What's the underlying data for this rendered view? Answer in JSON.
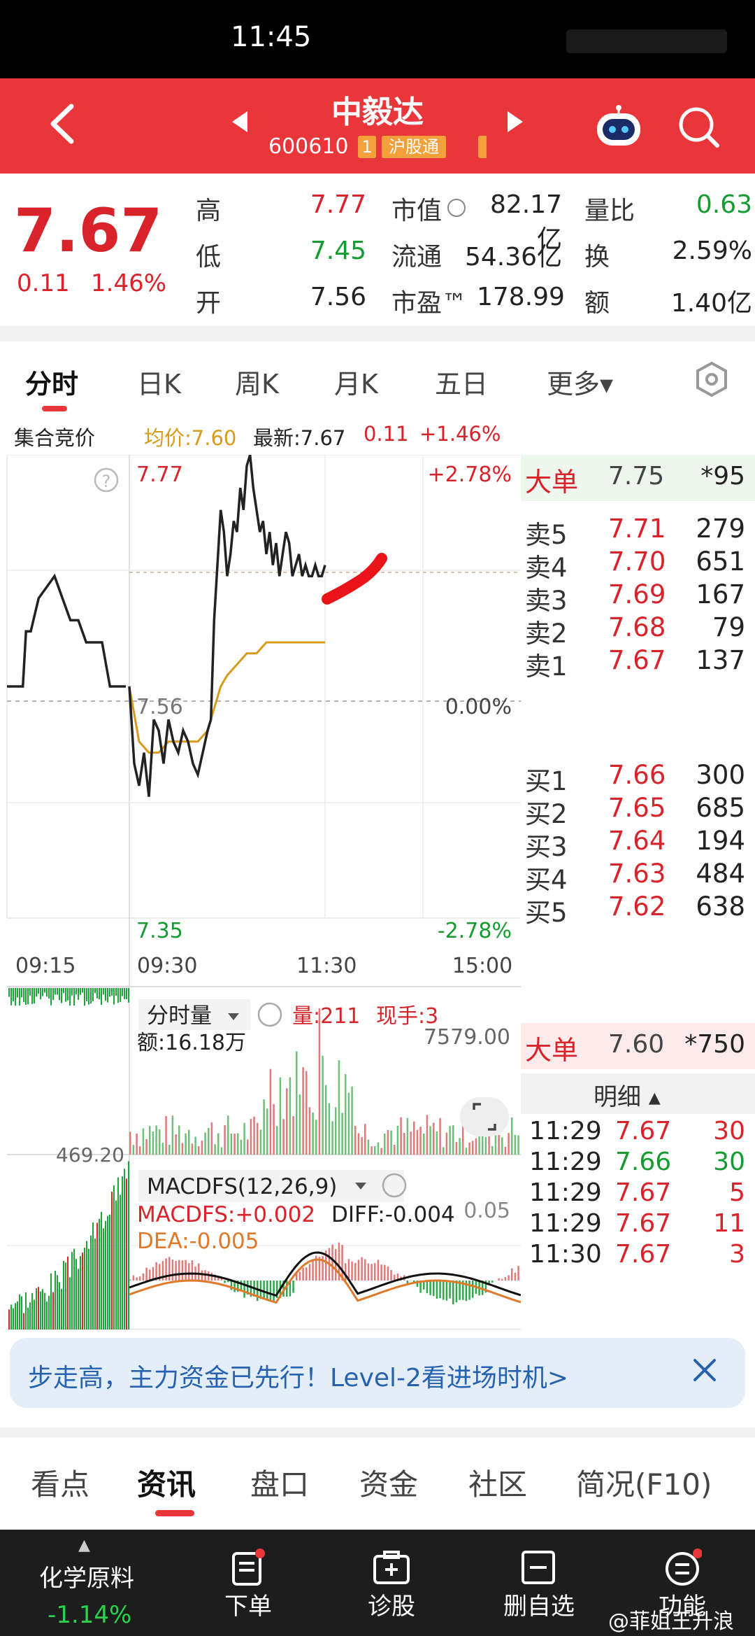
{
  "status_bar": {
    "time": "11:45"
  },
  "header": {
    "stock_name": "中毅达",
    "stock_code": "600610",
    "level_badge": "1",
    "market_badge": "沪股通",
    "back_icon": "chevron-left-icon",
    "prev_icon": "triangle-left-icon",
    "next_icon": "triangle-right-icon",
    "robot_icon": "robot-assistant-icon",
    "search_icon": "search-icon"
  },
  "quote": {
    "price": "7.67",
    "change": "0.11",
    "change_pct": "1.46%",
    "high_label": "高",
    "high": "7.77",
    "low_label": "低",
    "low": "7.45",
    "open_label": "开",
    "open": "7.56",
    "mktcap_label": "市值",
    "mktcap": "82.17亿",
    "float_label": "流通",
    "float": "54.36亿",
    "pe_label": "市盈™",
    "pe": "178.99",
    "volratio_label": "量比",
    "volratio": "0.63",
    "turnover_label": "换",
    "turnover": "2.59%",
    "amount_label": "额",
    "amount": "1.40亿"
  },
  "kline_tabs": [
    "分时",
    "日K",
    "周K",
    "月K",
    "五日",
    "更多▾"
  ],
  "info_line": {
    "auction": "集合竞价",
    "avg_price": "均价:7.60",
    "latest": "最新:7.67",
    "latest_chg": "0.11",
    "latest_pct": "+1.46%"
  },
  "chart_data": [
    {
      "type": "line",
      "title": "",
      "x_ticks": [
        "09:15",
        "09:30",
        "11:30",
        "15:00"
      ],
      "ylim": [
        7.35,
        7.77
      ],
      "y_labels": {
        "top": "7.77",
        "mid": "7.56",
        "bottom": "7.35"
      },
      "pct_labels": {
        "top": "+2.78%",
        "mid": "0.00%",
        "bottom": "-2.78%"
      },
      "series": [
        {
          "name": "",
          "color": "#222222",
          "points": [
            [
              0,
              7.56
            ],
            [
              3,
              7.49
            ],
            [
              6,
              7.47
            ],
            [
              9,
              7.5
            ],
            [
              12,
              7.46
            ],
            [
              15,
              7.53
            ],
            [
              18,
              7.52
            ],
            [
              21,
              7.49
            ],
            [
              24,
              7.53
            ],
            [
              27,
              7.51
            ],
            [
              30,
              7.5
            ],
            [
              33,
              7.52
            ],
            [
              36,
              7.51
            ],
            [
              39,
              7.49
            ],
            [
              42,
              7.48
            ],
            [
              45,
              7.5
            ],
            [
              48,
              7.52
            ],
            [
              50,
              7.53
            ],
            [
              52,
              7.62
            ],
            [
              54,
              7.67
            ],
            [
              56,
              7.72
            ],
            [
              58,
              7.7
            ],
            [
              60,
              7.66
            ],
            [
              62,
              7.68
            ],
            [
              64,
              7.71
            ],
            [
              66,
              7.7
            ],
            [
              68,
              7.74
            ],
            [
              70,
              7.72
            ],
            [
              72,
              7.76
            ],
            [
              74,
              7.77
            ],
            [
              76,
              7.74
            ],
            [
              78,
              7.72
            ],
            [
              80,
              7.7
            ],
            [
              82,
              7.71
            ],
            [
              84,
              7.68
            ],
            [
              86,
              7.7
            ],
            [
              88,
              7.67
            ],
            [
              90,
              7.69
            ],
            [
              92,
              7.66
            ],
            [
              94,
              7.68
            ],
            [
              96,
              7.7
            ],
            [
              98,
              7.69
            ],
            [
              100,
              7.66
            ],
            [
              102,
              7.67
            ],
            [
              104,
              7.68
            ],
            [
              106,
              7.66
            ],
            [
              108,
              7.67
            ],
            [
              110,
              7.66
            ],
            [
              112,
              7.66
            ],
            [
              114,
              7.67
            ],
            [
              116,
              7.66
            ],
            [
              118,
              7.66
            ],
            [
              120,
              7.67
            ]
          ]
        },
        {
          "name": "均价",
          "color": "#d69b1c",
          "points": [
            [
              0,
              7.56
            ],
            [
              6,
              7.51
            ],
            [
              12,
              7.5
            ],
            [
              18,
              7.5
            ],
            [
              24,
              7.51
            ],
            [
              30,
              7.51
            ],
            [
              36,
              7.51
            ],
            [
              42,
              7.51
            ],
            [
              48,
              7.52
            ],
            [
              52,
              7.54
            ],
            [
              56,
              7.56
            ],
            [
              60,
              7.57
            ],
            [
              66,
              7.58
            ],
            [
              72,
              7.59
            ],
            [
              78,
              7.59
            ],
            [
              84,
              7.6
            ],
            [
              90,
              7.6
            ],
            [
              96,
              7.6
            ],
            [
              102,
              7.6
            ],
            [
              108,
              7.6
            ],
            [
              114,
              7.6
            ],
            [
              120,
              7.6
            ]
          ]
        }
      ],
      "preopen_series": [
        [
          0,
          7.56
        ],
        [
          2,
          7.56
        ],
        [
          2.4,
          7.61
        ],
        [
          3,
          7.61
        ],
        [
          4,
          7.64
        ],
        [
          5,
          7.65
        ],
        [
          6,
          7.66
        ],
        [
          7,
          7.64
        ],
        [
          8,
          7.62
        ],
        [
          9,
          7.62
        ],
        [
          10,
          7.6
        ],
        [
          11,
          7.6
        ],
        [
          12,
          7.6
        ],
        [
          13,
          7.56
        ],
        [
          14,
          7.56
        ],
        [
          15,
          7.56
        ]
      ]
    },
    {
      "type": "bar",
      "title": "分时量",
      "volume_label": "量:211",
      "hand_label": "现手:3",
      "amount_label": "额:16.18万",
      "ymax_label": "7579.00",
      "preopen_label": "469.20"
    },
    {
      "type": "bar",
      "title": "MACDFS(12,26,9)",
      "macd_label": "MACDFS:+0.002",
      "diff_label": "DIFF:-0.004",
      "dea_label": "DEA:-0.005",
      "side_label": "0.05"
    }
  ],
  "orderbook": {
    "big_order_label": "大单",
    "big_order_top": {
      "price": "7.75",
      "vol": "*95"
    },
    "asks": [
      {
        "label": "卖5",
        "price": "7.71",
        "vol": "279"
      },
      {
        "label": "卖4",
        "price": "7.70",
        "vol": "651"
      },
      {
        "label": "卖3",
        "price": "7.69",
        "vol": "167"
      },
      {
        "label": "卖2",
        "price": "7.68",
        "vol": "79"
      },
      {
        "label": "卖1",
        "price": "7.67",
        "vol": "137"
      }
    ],
    "bids": [
      {
        "label": "买1",
        "price": "7.66",
        "vol": "300"
      },
      {
        "label": "买2",
        "price": "7.65",
        "vol": "685"
      },
      {
        "label": "买3",
        "price": "7.64",
        "vol": "194"
      },
      {
        "label": "买4",
        "price": "7.63",
        "vol": "484"
      },
      {
        "label": "买5",
        "price": "7.62",
        "vol": "638"
      }
    ],
    "big_order_bottom": {
      "price": "7.60",
      "vol": "*750"
    },
    "detail_label": "明细 ▴",
    "ticks": [
      {
        "time": "11:29",
        "price": "7.67",
        "vol": "30",
        "dir": "red"
      },
      {
        "time": "11:29",
        "price": "7.66",
        "vol": "30",
        "dir": "green"
      },
      {
        "time": "11:29",
        "price": "7.67",
        "vol": "5",
        "dir": "red"
      },
      {
        "time": "11:29",
        "price": "7.67",
        "vol": "11",
        "dir": "red"
      },
      {
        "time": "11:30",
        "price": "7.67",
        "vol": "3",
        "dir": "red"
      }
    ]
  },
  "banner": {
    "text": "步走高，主力资金已先行！Level-2看进场时机>",
    "close_icon": "close-icon"
  },
  "news_tabs": [
    "看点",
    "资讯",
    "盘口",
    "资金",
    "社区",
    "简况(F10)"
  ],
  "bottom_bar": {
    "sector_name": "化学原料",
    "sector_pct": "-1.14%",
    "items": [
      {
        "label": "下单",
        "icon": "order-icon"
      },
      {
        "label": "诊股",
        "icon": "diagnose-icon"
      },
      {
        "label": "删自选",
        "icon": "remove-watchlist-icon"
      },
      {
        "label": "功能",
        "icon": "menu-icon"
      }
    ]
  },
  "watermark": "@菲姐王升浪",
  "colors": {
    "up": "#d8232a",
    "down": "#149c31",
    "header": "#e8363a",
    "avg": "#d69b1c"
  }
}
